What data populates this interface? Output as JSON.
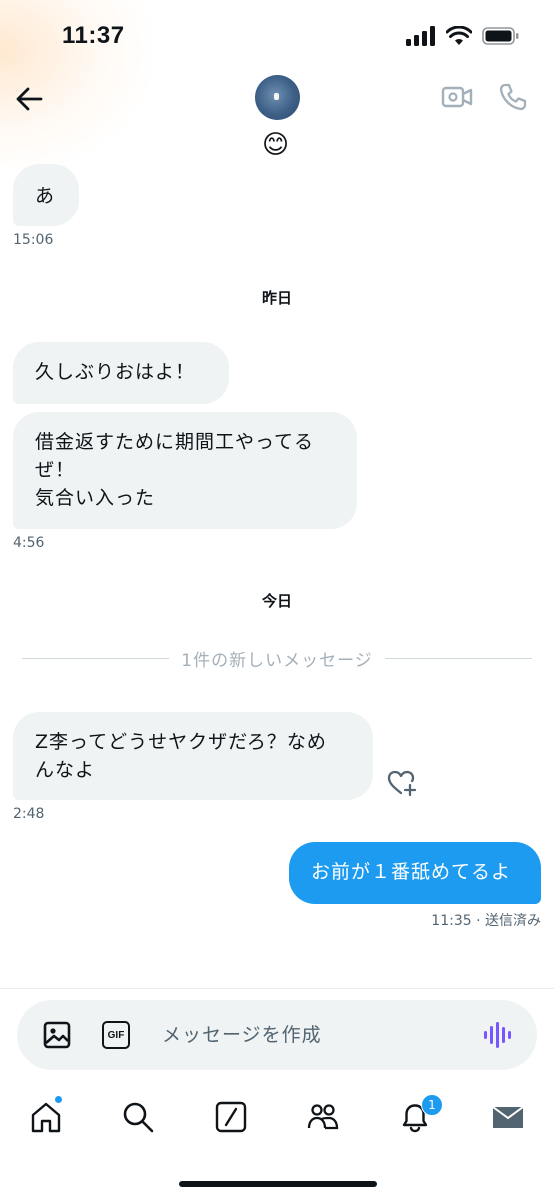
{
  "status_bar": {
    "time": "11:37"
  },
  "header": {
    "emoji": "😊",
    "icons": {
      "back": "arrow-left-icon",
      "video": "video-camera-icon",
      "call": "phone-icon"
    }
  },
  "messages": [
    {
      "direction": "in",
      "text": "あ"
    },
    {
      "time": "15:06"
    },
    {
      "day_label": "昨日"
    },
    {
      "direction": "in",
      "text": "久しぶりおはよ！"
    },
    {
      "direction": "in",
      "lines": [
        "借金返すために期間工やってる",
        "ぜ！",
        "気合い入った"
      ]
    },
    {
      "time": "4:56"
    },
    {
      "day_label": "今日"
    },
    {
      "new_messages_label": "1件の新しいメッセージ"
    },
    {
      "direction": "in",
      "lines": [
        "Z李ってどうせヤクザだろ？なめ",
        "んなよ"
      ]
    },
    {
      "time": "2:48"
    },
    {
      "direction": "out",
      "text": "お前が１番舐めてるよ"
    },
    {
      "time_status": "11:35 · 送信済み"
    }
  ],
  "composer": {
    "placeholder": "メッセージを作成",
    "gif_label": "GIF",
    "icons": {
      "image": "image-icon",
      "gif": "gif-icon",
      "voice": "voice-wave-icon"
    }
  },
  "tabbar": {
    "items": [
      {
        "name": "home",
        "icon": "home-icon",
        "has_dot": true
      },
      {
        "name": "search",
        "icon": "search-icon"
      },
      {
        "name": "grok",
        "icon": "grok-icon"
      },
      {
        "name": "communities",
        "icon": "people-icon"
      },
      {
        "name": "notifications",
        "icon": "bell-icon",
        "badge": "1"
      },
      {
        "name": "messages",
        "icon": "envelope-icon",
        "active": true
      }
    ]
  },
  "colors": {
    "accent": "#1d9bf0",
    "bubble_in": "#eff3f4",
    "voice": "#7856ff"
  }
}
